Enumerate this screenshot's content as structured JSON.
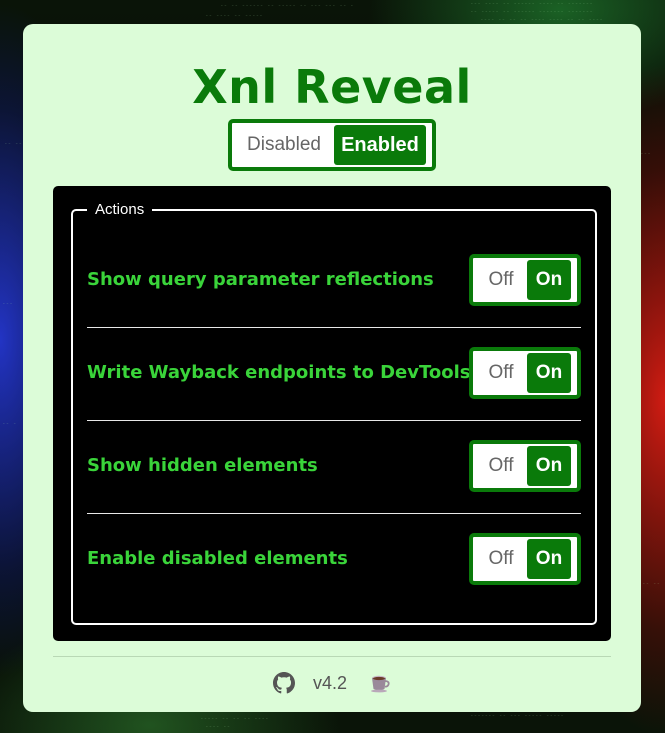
{
  "app": {
    "title": "Xnl Reveal"
  },
  "master_toggle": {
    "off_label": "Disabled",
    "on_label": "Enabled",
    "state": "Enabled"
  },
  "actions": {
    "legend": "Actions",
    "items": [
      {
        "label": "Show query parameter reflections",
        "off_label": "Off",
        "on_label": "On",
        "state": "On"
      },
      {
        "label": "Write Wayback endpoints to DevTools",
        "off_label": "Off",
        "on_label": "On",
        "state": "On"
      },
      {
        "label": "Show hidden elements",
        "off_label": "Off",
        "on_label": "On",
        "state": "On"
      },
      {
        "label": "Enable disabled elements",
        "off_label": "Off",
        "on_label": "On",
        "state": "On"
      }
    ]
  },
  "footer": {
    "github_icon": "github-icon",
    "version": "v4.2",
    "coffee_icon": "coffee-cup-icon"
  },
  "colors": {
    "accent": "#0a7a0a",
    "label_green": "#3ad43a",
    "card_bg": "#dcfcd8",
    "panel_bg": "#000000"
  }
}
